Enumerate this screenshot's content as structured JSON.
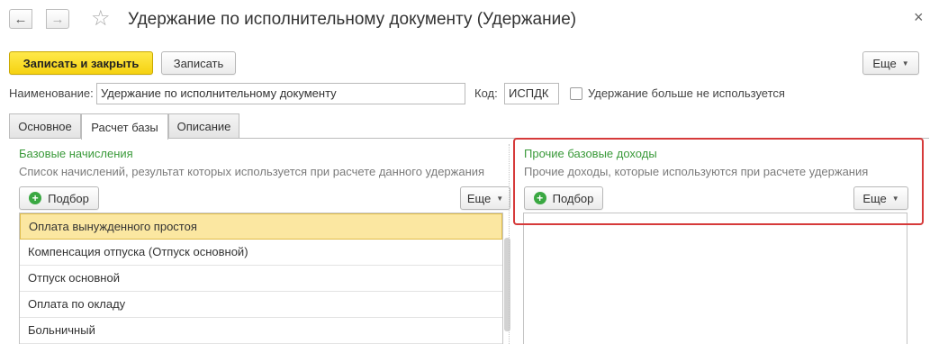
{
  "window": {
    "title": "Удержание по исполнительному документу (Удержание)",
    "back_icon": "←",
    "forward_icon": "→",
    "star_icon": "☆",
    "close_icon": "×"
  },
  "toolbar": {
    "save_close_label": "Записать и закрыть",
    "save_label": "Записать",
    "more_label": "Еще"
  },
  "form": {
    "name_label": "Наименование:",
    "name_value": "Удержание по исполнительному документу",
    "code_label": "Код:",
    "code_value": "ИСПДК",
    "unused_label": "Удержание больше не используется",
    "unused_checked": false
  },
  "tabs": [
    {
      "label": "Основное",
      "active": false
    },
    {
      "label": "Расчет базы",
      "active": true
    },
    {
      "label": "Описание",
      "active": false
    }
  ],
  "left_panel": {
    "title": "Базовые начисления",
    "description": "Список начислений, результат которых используется при расчете данного удержания",
    "pick_label": "Подбор",
    "more_label": "Еще",
    "items": [
      "Оплата вынужденного простоя",
      "Компенсация отпуска (Отпуск основной)",
      "Отпуск основной",
      "Оплата по окладу",
      "Больничный"
    ],
    "selected_index": 0
  },
  "right_panel": {
    "title": "Прочие базовые доходы",
    "description": "Прочие доходы, которые используются при расчете удержания",
    "pick_label": "Подбор",
    "more_label": "Еще",
    "items": []
  },
  "colors": {
    "primary_button": "#f5d211",
    "section_title": "#3a9a3a",
    "highlight": "#d63a3a",
    "selected_row": "#fbe7a1"
  }
}
